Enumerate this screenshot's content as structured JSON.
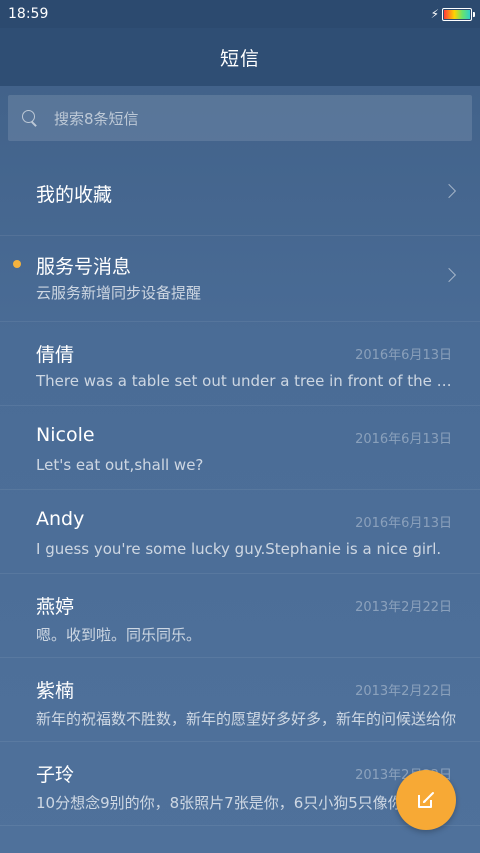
{
  "status_bar": {
    "time": "18:59"
  },
  "header": {
    "title": "短信"
  },
  "search": {
    "placeholder": "搜索8条短信"
  },
  "favorites": {
    "label": "我的收藏"
  },
  "service": {
    "title": "服务号消息",
    "subtitle": "云服务新增同步设备提醒",
    "unread_color": "#f4b23e"
  },
  "conversations": [
    {
      "name": "倩倩",
      "date": "2016年6月13日",
      "preview": "There was a table set out under a tree in front of the house"
    },
    {
      "name": "Nicole",
      "date": "2016年6月13日",
      "preview": "Let's eat out,shall we?"
    },
    {
      "name": "Andy",
      "date": "2016年6月13日",
      "preview": "I guess you're some lucky guy.Stephanie is a nice girl."
    },
    {
      "name": "燕婷",
      "date": "2013年2月22日",
      "preview": "嗯。收到啦。同乐同乐。"
    },
    {
      "name": "紫楠",
      "date": "2013年2月22日",
      "preview": "新年的祝福数不胜数，新年的愿望好多好多，新年的问候送给你"
    },
    {
      "name": "子玲",
      "date": "2013年2月22日",
      "preview": "10分想念9别的你，8张照片7张是你，6只小狗5只像你"
    }
  ],
  "fab": {
    "icon": "compose-icon",
    "color": "#f7a935"
  }
}
